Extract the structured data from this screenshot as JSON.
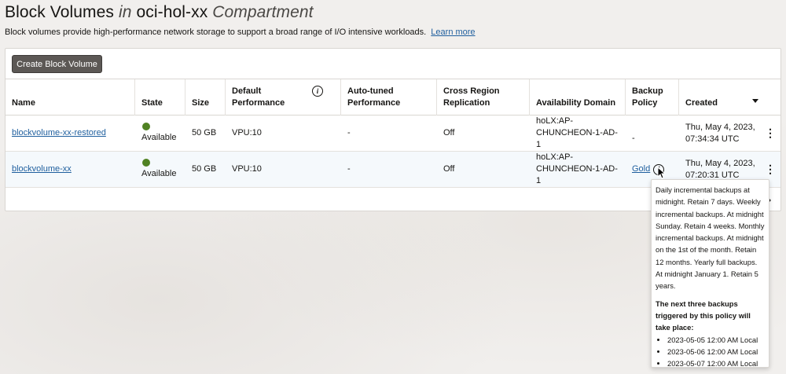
{
  "header": {
    "title_part1": "Block Volumes",
    "title_in": "in",
    "title_compartment": "oci-hol-xx",
    "title_suffix": "Compartment",
    "description": "Block volumes provide high-performance network storage to support a broad range of I/O intensive workloads.",
    "learn_more": "Learn more"
  },
  "toolbar": {
    "create_label": "Create Block Volume"
  },
  "table": {
    "columns": {
      "name": "Name",
      "state": "State",
      "size": "Size",
      "default_perf": "Default Performance",
      "auto_tuned": "Auto-tuned Performance",
      "cross_region": "Cross Region Replication",
      "ad": "Availability Domain",
      "backup": "Backup Policy",
      "created": "Created"
    },
    "rows": [
      {
        "name": "blockvolume-xx-restored",
        "state": "Available",
        "size": "50 GB",
        "default_perf": "VPU:10",
        "auto_tuned": "-",
        "cross_region": "Off",
        "ad": "hoLX:AP-CHUNCHEON-1-AD-1",
        "backup": "-",
        "created": "Thu, May 4, 2023, 07:34:34 UTC"
      },
      {
        "name": "blockvolume-xx",
        "state": "Available",
        "size": "50 GB",
        "default_perf": "VPU:10",
        "auto_tuned": "-",
        "cross_region": "Off",
        "ad": "hoLX:AP-CHUNCHEON-1-AD-1",
        "backup": "Gold",
        "created": "Thu, May 4, 2023, 07:20:31 UTC"
      }
    ]
  },
  "tooltip": {
    "policy_text": "Daily incremental backups at midnight. Retain 7 days. Weekly incremental backups. At midnight Sunday. Retain 4 weeks. Monthly incremental backups. At midnight on the 1st of the month. Retain 12 months. Yearly full backups. At midnight January 1. Retain 5 years.",
    "next_heading": "The next three backups triggered by this policy will take place:",
    "next_backups": [
      "2023-05-05 12:00 AM Local",
      "2023-05-06 12:00 AM Local",
      "2023-05-07 12:00 AM Local"
    ]
  },
  "colors": {
    "available": "#508223",
    "link": "#1f5f9e",
    "button_bg": "#5c5855"
  },
  "icons": {
    "info": "info-icon",
    "sort": "sort-desc-icon",
    "actions": "kebab-icon",
    "pager": "chevron-right-icon"
  }
}
